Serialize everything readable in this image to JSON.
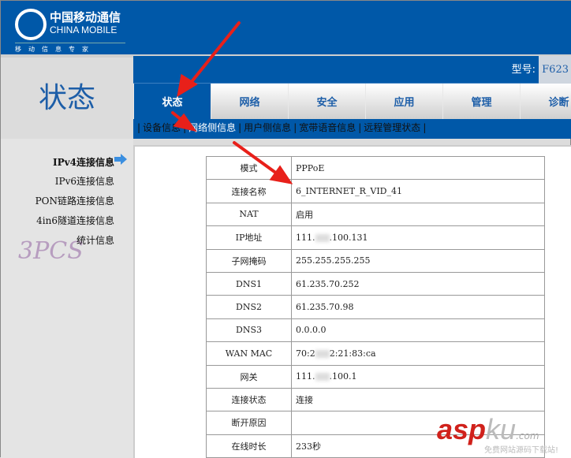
{
  "brand": {
    "cn": "中国移动通信",
    "en": "CHINA MOBILE",
    "slogan": "移动信息专家"
  },
  "section_title": "状态",
  "model": {
    "label": "型号:",
    "value": "F623"
  },
  "tabs": [
    {
      "label": "状态"
    },
    {
      "label": "网络"
    },
    {
      "label": "安全"
    },
    {
      "label": "应用"
    },
    {
      "label": "管理"
    },
    {
      "label": "诊断"
    }
  ],
  "subnav": [
    {
      "label": "设备信息"
    },
    {
      "label": "网络侧信息"
    },
    {
      "label": "用户侧信息"
    },
    {
      "label": "宽带语音信息"
    },
    {
      "label": "远程管理状态"
    }
  ],
  "sidebar": [
    {
      "label": "IPv4连接信息"
    },
    {
      "label": "IPv6连接信息"
    },
    {
      "label": "PON链路连接信息"
    },
    {
      "label": "4in6隧道连接信息"
    },
    {
      "label": "统计信息"
    }
  ],
  "rows": [
    {
      "k": "模式",
      "v": "PPPoE"
    },
    {
      "k": "连接名称",
      "v": "6_INTERNET_R_VID_41"
    },
    {
      "k": "NAT",
      "v": "启用"
    },
    {
      "k": "IP地址",
      "v": "111.",
      "v2": ".100.131"
    },
    {
      "k": "子网掩码",
      "v": "255.255.255.255"
    },
    {
      "k": "DNS1",
      "v": "61.235.70.252"
    },
    {
      "k": "DNS2",
      "v": "61.235.70.98"
    },
    {
      "k": "DNS3",
      "v": "0.0.0.0"
    },
    {
      "k": "WAN MAC",
      "v": "70:2",
      "v2": "2:21:83:ca"
    },
    {
      "k": "网关",
      "v": "111.",
      "v2": ".100.1"
    },
    {
      "k": "连接状态",
      "v": "连接"
    },
    {
      "k": "断开原因",
      "v": ""
    },
    {
      "k": "在线时长",
      "v": "233秒"
    }
  ],
  "watermarks": {
    "pcs": "3PCS",
    "aspku": "asp",
    "aspku2": "ku",
    "aspku3": ".com",
    "aspku_sub": "免费网站源码下载站!"
  }
}
